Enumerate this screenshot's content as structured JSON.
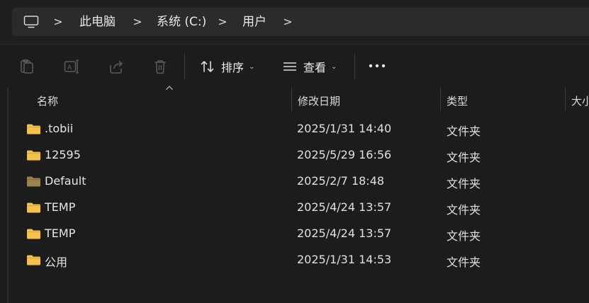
{
  "breadcrumb": {
    "items": [
      "此电脑",
      "系统 (C:)",
      "用户"
    ],
    "separator": ">"
  },
  "toolbar": {
    "sort_label": "排序",
    "view_label": "查看",
    "more_label": "..."
  },
  "columns": {
    "name": "名称",
    "date": "修改日期",
    "type": "类型",
    "size": "大小"
  },
  "files": [
    {
      "name": ".tobii",
      "date": "2025/1/31 14:40",
      "type": "文件夹",
      "icon": "folder-icon"
    },
    {
      "name": "12595",
      "date": "2025/5/29 16:56",
      "type": "文件夹",
      "icon": "folder-icon"
    },
    {
      "name": "Default",
      "date": "2025/2/7 18:48",
      "type": "文件夹",
      "icon": "folder-dim-icon"
    },
    {
      "name": "TEMP",
      "date": "2025/4/24 13:57",
      "type": "文件夹",
      "icon": "folder-icon"
    },
    {
      "name": "TEMP",
      "date": "2025/4/24 13:57",
      "type": "文件夹",
      "icon": "folder-icon"
    },
    {
      "name": "公用",
      "date": "2025/1/31 14:53",
      "type": "文件夹",
      "icon": "folder-icon"
    }
  ],
  "colors": {
    "folder": "#f2c14e",
    "folder_dim": "#9a8350",
    "background": "#1c1c1c",
    "address_bg": "#2b2b2b"
  }
}
